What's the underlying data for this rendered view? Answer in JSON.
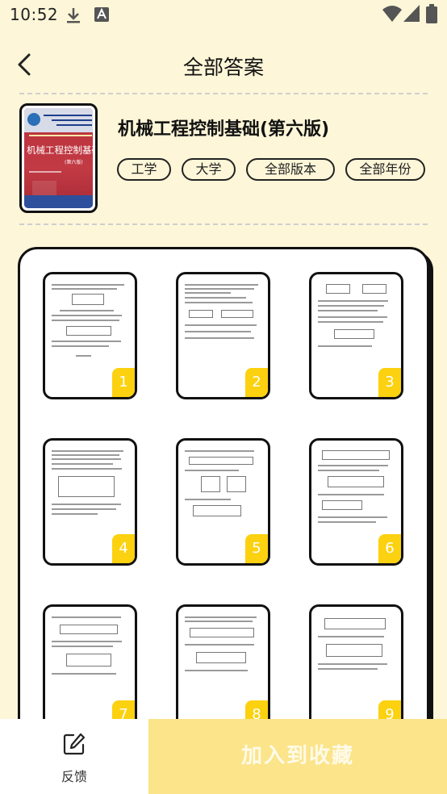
{
  "status_bar": {
    "time": "10:52"
  },
  "header": {
    "title": "全部答案"
  },
  "book": {
    "title": "机械工程控制基础(第六版)",
    "cover_title": "机械工程控制基础",
    "cover_edition": "(第六版)",
    "tags": [
      "工学",
      "大学",
      "全部版本",
      "全部年份"
    ]
  },
  "pages": [
    {
      "number": "1"
    },
    {
      "number": "2"
    },
    {
      "number": "3"
    },
    {
      "number": "4"
    },
    {
      "number": "5"
    },
    {
      "number": "6"
    },
    {
      "number": "7"
    },
    {
      "number": "8"
    },
    {
      "number": "9"
    }
  ],
  "bottom_bar": {
    "feedback_label": "反馈",
    "collect_label": "加入到收藏"
  },
  "colors": {
    "accent": "#fcd10f",
    "background": "#fdf6d8",
    "collect_button": "#fbe48a"
  },
  "icons": {
    "back": "chevron-left-icon",
    "download": "download-icon",
    "keyboard": "a-icon",
    "wifi": "wifi-icon",
    "signal": "signal-icon",
    "battery": "battery-icon",
    "feedback": "edit-icon"
  }
}
